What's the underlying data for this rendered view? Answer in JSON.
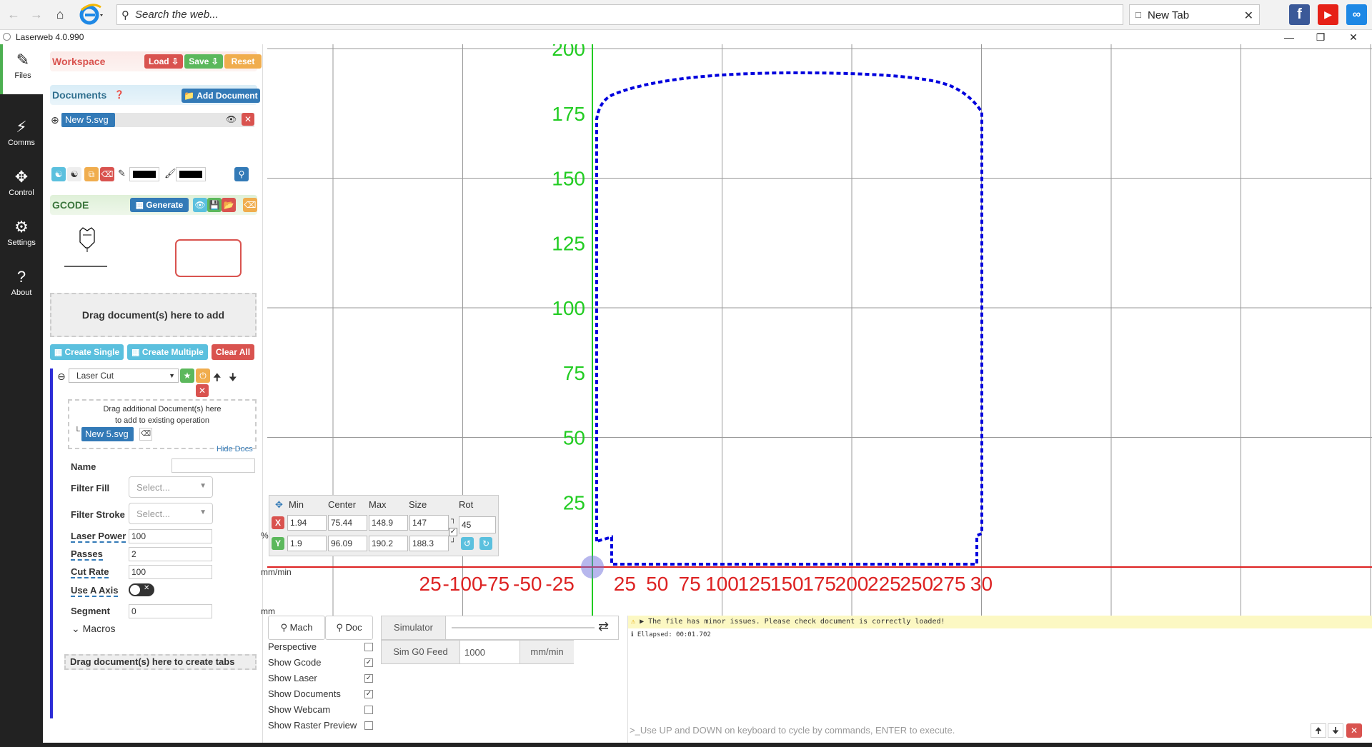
{
  "browser": {
    "search_placeholder": "Search the web...",
    "tab_label": "New Tab",
    "back_icon": "back-arrow-icon",
    "forward_icon": "forward-arrow-icon",
    "home_icon": "home-icon"
  },
  "app": {
    "title": "Laserweb 4.0.990"
  },
  "leftnav": {
    "items": [
      {
        "label": "Files",
        "icon": "files-icon"
      },
      {
        "label": "Comms",
        "icon": "plug-icon"
      },
      {
        "label": "Control",
        "icon": "arrows-icon"
      },
      {
        "label": "Settings",
        "icon": "gear-icon"
      },
      {
        "label": "About",
        "icon": "question-icon"
      }
    ]
  },
  "workspace": {
    "title": "Workspace",
    "load": "Load",
    "save": "Save",
    "reset": "Reset"
  },
  "documents": {
    "title": "Documents",
    "add": "Add Document",
    "file": "New 5.svg"
  },
  "gcode": {
    "title": "GCODE",
    "generate": "Generate"
  },
  "dropzone": {
    "text": "Drag document(s) here to add"
  },
  "ops_buttons": {
    "create_single": "Create Single",
    "create_multiple": "Create Multiple",
    "clear_all": "Clear All"
  },
  "operation": {
    "type": "Laser Cut",
    "drag_text_1": "Drag additional Document(s) here",
    "drag_text_2": "to add to existing operation",
    "doc": "New 5.svg",
    "hide_docs": "Hide Docs",
    "fields": {
      "name_label": "Name",
      "name_value": "",
      "filter_fill_label": "Filter Fill",
      "filter_fill_placeholder": "Select...",
      "filter_stroke_label": "Filter Stroke",
      "filter_stroke_placeholder": "Select...",
      "laser_power_label": "Laser Power",
      "laser_power_value": "100",
      "laser_power_unit": "%",
      "passes_label": "Passes",
      "passes_value": "2",
      "cut_rate_label": "Cut Rate",
      "cut_rate_value": "100",
      "cut_rate_unit": "mm/min",
      "use_a_axis_label": "Use A Axis",
      "segment_label": "Segment",
      "segment_value": "0",
      "segment_unit": "mm"
    },
    "macros": "Macros",
    "drag_tabs": "Drag document(s) here to create tabs"
  },
  "canvas": {
    "y_ticks": [
      "25",
      "50",
      "75",
      "100",
      "125",
      "150",
      "175",
      "200"
    ],
    "x_ticks": [
      "25",
      "-100",
      "-75",
      "-50",
      "-25",
      "25",
      "50",
      "75",
      "100",
      "125",
      "150",
      "175",
      "200",
      "225",
      "250",
      "275",
      "30"
    ],
    "axis_x_color": "#dd2222",
    "axis_y_color": "#22cc22",
    "shape_color": "#0000dd"
  },
  "dro": {
    "headers": [
      "Min",
      "Center",
      "Max",
      "Size",
      "Rot"
    ],
    "x_label": "X",
    "y_label": "Y",
    "x": {
      "min": "1.94",
      "center": "75.44",
      "max": "148.9",
      "size": "147"
    },
    "y": {
      "min": "1.9",
      "center": "96.09",
      "max": "190.2",
      "size": "188.3"
    },
    "rot": "45"
  },
  "view": {
    "mach": "Mach",
    "doc": "Doc",
    "simulator": "Simulator",
    "sim_g0_feed_label": "Sim G0 Feed",
    "sim_g0_feed_value": "1000",
    "sim_g0_feed_unit": "mm/min",
    "options": [
      {
        "label": "Perspective",
        "checked": false
      },
      {
        "label": "Show Gcode",
        "checked": true
      },
      {
        "label": "Show Laser",
        "checked": true
      },
      {
        "label": "Show Documents",
        "checked": true
      },
      {
        "label": "Show Webcam",
        "checked": false
      },
      {
        "label": "Show Raster Preview",
        "checked": false
      }
    ]
  },
  "console": {
    "warning": "▶ The file has minor issues. Please check document is correctly loaded!",
    "elapsed": "Ellapsed: 00:01.702",
    "placeholder": "Use UP and DOWN on keyboard to cycle by commands, ENTER to execute."
  }
}
